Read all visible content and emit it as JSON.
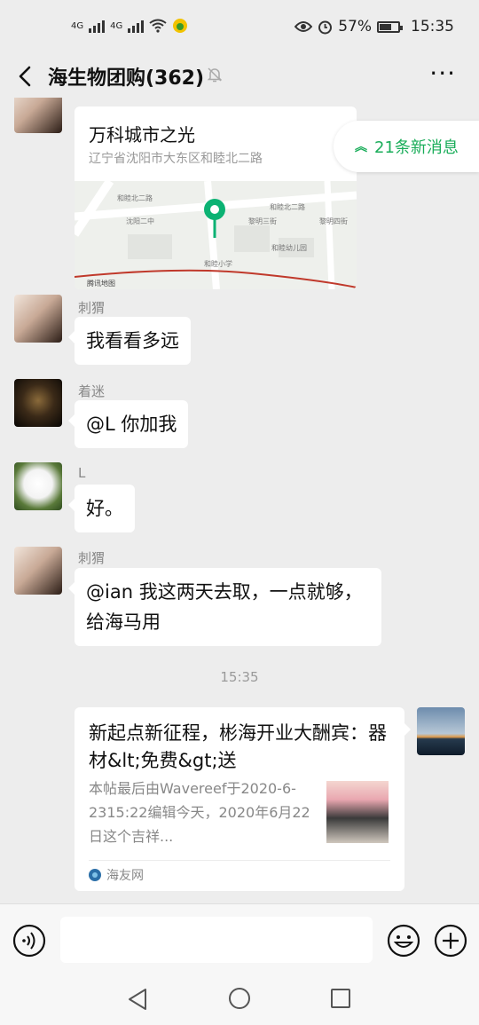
{
  "status_bar": {
    "net1": "4G",
    "net2": "4G",
    "battery_percent": "57%",
    "battery_level": 0.57,
    "time": "15:35"
  },
  "header": {
    "title": "海生物团购(362)",
    "more_label": "···"
  },
  "new_messages": {
    "label": "21条新消息"
  },
  "location_card": {
    "title": "万科城市之光",
    "address": "辽宁省沈阳市大东区和睦北二路",
    "map_provider": "腾讯地图",
    "map_labels": [
      "和睦北二路",
      "和睦北二路",
      "黎明三街",
      "黎明四街",
      "沈阳二中",
      "和睦幼儿园",
      "和睦小学",
      "腾讯地图"
    ]
  },
  "messages": [
    {
      "sender": "刺猬",
      "text": "我看看多远"
    },
    {
      "sender": "着迷",
      "text": "@L  你加我"
    },
    {
      "sender": "L",
      "text": "好。"
    },
    {
      "sender": "刺猬",
      "text": "@ian  我这两天去取，一点就够，给海马用"
    }
  ],
  "timestamp": "15:35",
  "link_card": {
    "title": "新起点新征程，彬海开业大酬宾：器材&lt;免费&gt;送",
    "description": "本帖最后由Wavereef于2020-6-2315:22编辑今天，2020年6月22日这个吉祥...",
    "source": "海友网"
  },
  "input": {
    "placeholder": ""
  },
  "colors": {
    "accent_green": "#1aad5a",
    "chat_background": "#ededed",
    "bubble": "#ffffff"
  }
}
